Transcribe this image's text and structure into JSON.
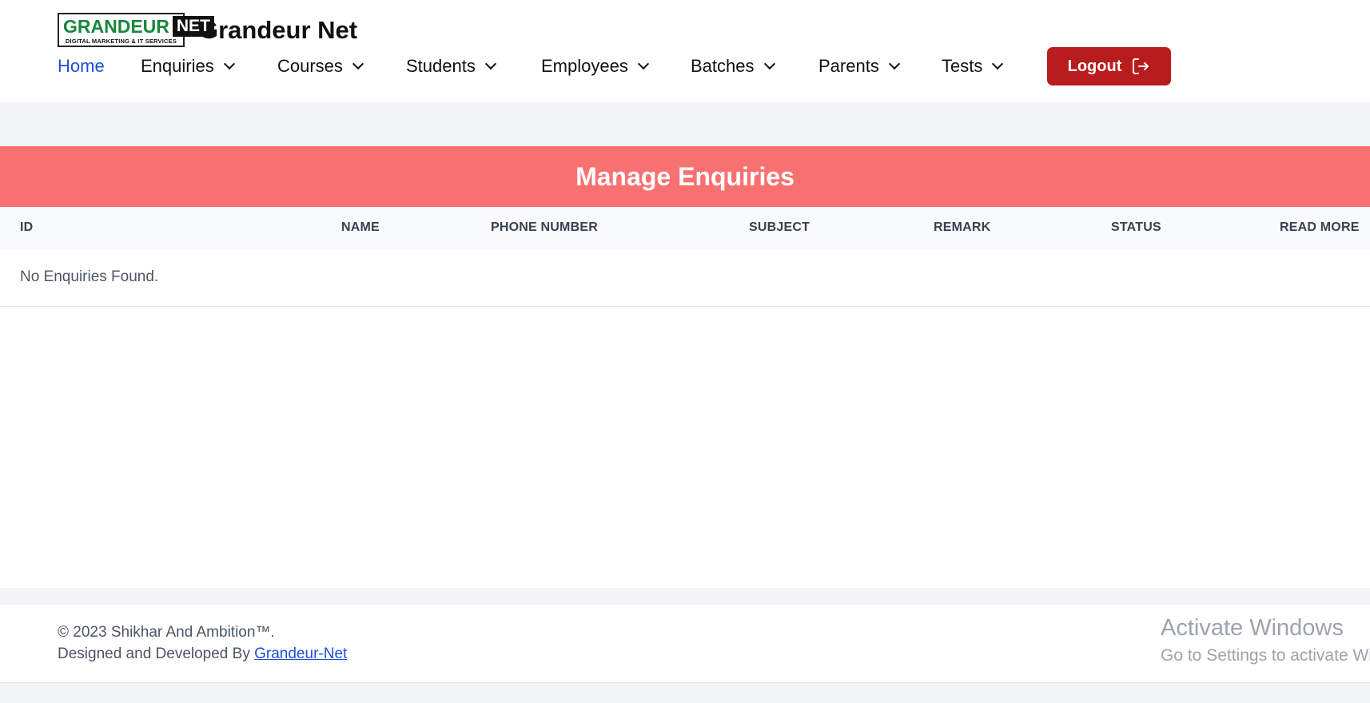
{
  "brand": {
    "logo_main": "GRANDEUR",
    "logo_tag": "NET",
    "logo_sub": "DIGITAL MARKETING & IT SERVICES",
    "name": "Grandeur Net"
  },
  "nav": {
    "items": [
      {
        "label": "Home",
        "active": true,
        "dropdown": false
      },
      {
        "label": "Enquiries",
        "dropdown": true
      },
      {
        "label": "Courses",
        "dropdown": true
      },
      {
        "label": "Students",
        "dropdown": true
      },
      {
        "label": "Employees",
        "dropdown": true
      },
      {
        "label": "Batches",
        "dropdown": true
      },
      {
        "label": "Parents",
        "dropdown": true
      },
      {
        "label": "Tests",
        "dropdown": true
      }
    ],
    "logout_label": "Logout"
  },
  "page": {
    "title": "Manage Enquiries"
  },
  "table": {
    "columns": [
      "ID",
      "NAME",
      "PHONE NUMBER",
      "SUBJECT",
      "REMARK",
      "STATUS",
      "READ MORE"
    ],
    "empty_message": "No Enquiries Found."
  },
  "footer": {
    "copyright": "© 2023 Shikhar And Ambition™.",
    "designed_prefix": "Designed and Developed By",
    "designed_link": "Grandeur-Net"
  },
  "watermark": {
    "line1": "Activate Windows",
    "line2": "Go to Settings to activate Windows."
  },
  "colors": {
    "accent_red": "#b91c1c",
    "title_bar": "#f87171",
    "link_blue": "#1d4ed8",
    "logo_green": "#17873c"
  }
}
